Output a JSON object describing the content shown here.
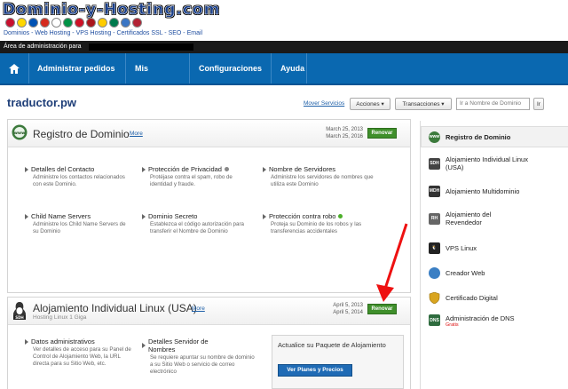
{
  "brand": {
    "logo": "Dominio-y-Hosting.com",
    "tagline": "Dominios - Web Hosting - VPS Hosting - Certificados SSL - SEO - Email",
    "flags": [
      "#c8102e",
      "#ffd700",
      "#0052b4",
      "#d52b1e",
      "#ffffff",
      "#009246",
      "#ce1126",
      "#aa151b",
      "#ffcc00",
      "#007a4d",
      "#3a75c4",
      "#b22234"
    ]
  },
  "admin_bar": {
    "label": "Área de administración para"
  },
  "nav": {
    "home_icon": "home-icon",
    "items": [
      "Administrar pedidos",
      "Mis cuentas",
      "Configuraciones",
      "Ayuda"
    ]
  },
  "page": {
    "title": "traductor.pw",
    "mover_servicios": "Mover Servicios",
    "acciones": "Acciones",
    "transacciones": "Transacciones",
    "search_placeholder": "Ir a Nombre de Dominio",
    "search_short": "Ir"
  },
  "domain_panel": {
    "title": "Registro de Dominio",
    "more": "More",
    "dates": [
      "March 25, 2013",
      "March 25, 2016"
    ],
    "renew": "Renovar",
    "features": [
      {
        "title": "Detalles del Contacto",
        "desc": "Administre los contactos relacionados con este Dominio."
      },
      {
        "title": "Protección de Privacidad",
        "desc": "Protéjase contra el spam, robo de identidad y fraude."
      },
      {
        "title": "Nombre de Servidores",
        "desc": "Administre los servidores de nombres que utiliza este Dominio"
      },
      {
        "title": "Child Name Servers",
        "desc": "Administre los Child Name Servers de su Dominio"
      },
      {
        "title": "Dominio Secreto",
        "desc": "Establezca el código autorización para transferir el Nombre de Dominio"
      },
      {
        "title": "Protección contra robo",
        "desc": "Proteja su Dominio de los robos y las transferencias accidentales"
      }
    ]
  },
  "hosting_panel": {
    "title": "Alojamiento Individual Linux (USA)",
    "subtitle": "Hosting Linux 1 Giga",
    "more": "More",
    "dates": [
      "April 5, 2013",
      "April 5, 2014"
    ],
    "renew": "Renovar",
    "features": [
      {
        "title": "Datos administrativos",
        "desc": "Ver detalles de acceso para su Panel de Control de Alojamiento Web, la URL directa para su Sitio Web, etc."
      },
      {
        "title": "Detalles Servidor de Nombres",
        "desc": "Se requiere apuntar su nombre de dominio a su Sitio Web o servicio de correo electrónico"
      }
    ],
    "upsell_title": "Actualice su Paquete de Alojamiento",
    "upsell_button": "Ver Planes y Precios"
  },
  "sidebar": {
    "items": [
      {
        "label": "Registro de Dominio",
        "icon": "www-icon",
        "color": "#3c7a3c"
      },
      {
        "label": "Alojamiento Individual Linux (USA)",
        "icon": "sdh-icon",
        "color": "#444444"
      },
      {
        "label": "Alojamiento Multidominio",
        "icon": "mdh-icon",
        "color": "#333333"
      },
      {
        "label": "Alojamiento del Revendedor",
        "icon": "rh-icon",
        "color": "#666666"
      },
      {
        "label": "VPS Linux",
        "icon": "tux-icon",
        "color": "#222222"
      },
      {
        "label": "Creador Web",
        "icon": "globe-icon",
        "color": "#3b7fc4"
      },
      {
        "label": "Certificado Digital",
        "icon": "shield-icon",
        "color": "#d9a520"
      },
      {
        "label": "Administración de DNS",
        "icon": "dns-icon",
        "color": "#2e6b3e",
        "badge": "Gratis"
      }
    ]
  },
  "annotation": {
    "color": "#ee1111"
  }
}
